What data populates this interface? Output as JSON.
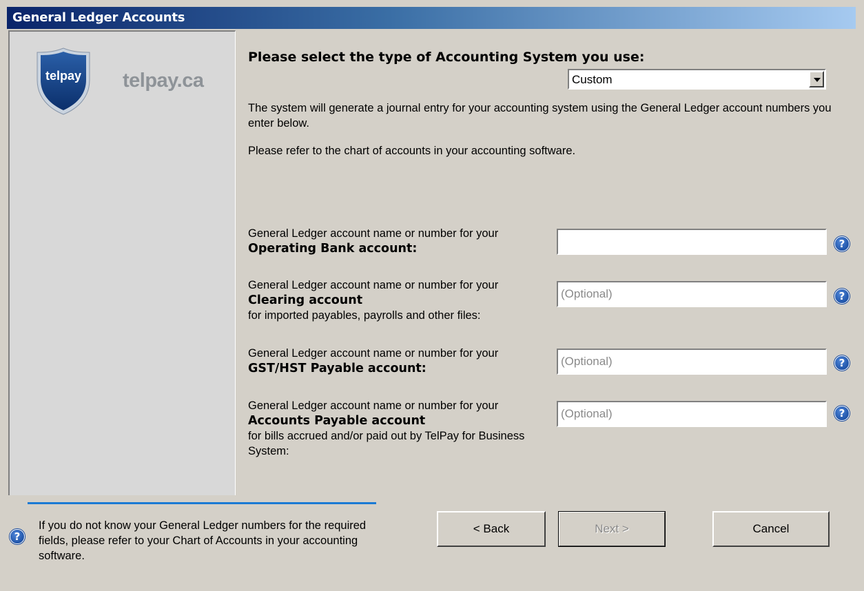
{
  "window": {
    "title": "General Ledger Accounts"
  },
  "branding": {
    "logo_text": "telpay",
    "site": "telpay.ca"
  },
  "main": {
    "heading": "Please select the type of Accounting System you use:",
    "system_select": {
      "value": "Custom"
    },
    "intro_1": "The system will generate a journal entry for your accounting system using the General Ledger account numbers you enter below.",
    "intro_2": "Please refer to the chart of accounts in your accounting software."
  },
  "fields": [
    {
      "prefix": "General Ledger account name or number for your",
      "name": "Operating Bank account:",
      "note": "",
      "value": "",
      "placeholder": ""
    },
    {
      "prefix": "General Ledger account name or number for your",
      "name": "Clearing account",
      "note": "for imported payables, payrolls and other files:",
      "value": "",
      "placeholder": "(Optional)"
    },
    {
      "prefix": "General Ledger account name or number for your",
      "name": "GST/HST Payable account:",
      "note": "",
      "value": "",
      "placeholder": "(Optional)"
    },
    {
      "prefix": "General Ledger account name or number for your",
      "name": "Accounts Payable account",
      "note": "for bills accrued and/or paid out by TelPay for Business System:",
      "value": "",
      "placeholder": "(Optional)"
    }
  ],
  "footer": {
    "help_text": "If you do not know your General Ledger numbers for the required fields, please refer to your Chart of Accounts in your accounting software.",
    "back_label": "< Back",
    "next_label": "Next >",
    "cancel_label": "Cancel"
  },
  "icons": {
    "help": "help-icon",
    "dropdown": "chevron-down-icon"
  },
  "colors": {
    "title_bar_start": "#0a246a",
    "title_bar_end": "#a6caf0",
    "divider": "#1a7ad4",
    "help_icon": "#0b3e94"
  }
}
